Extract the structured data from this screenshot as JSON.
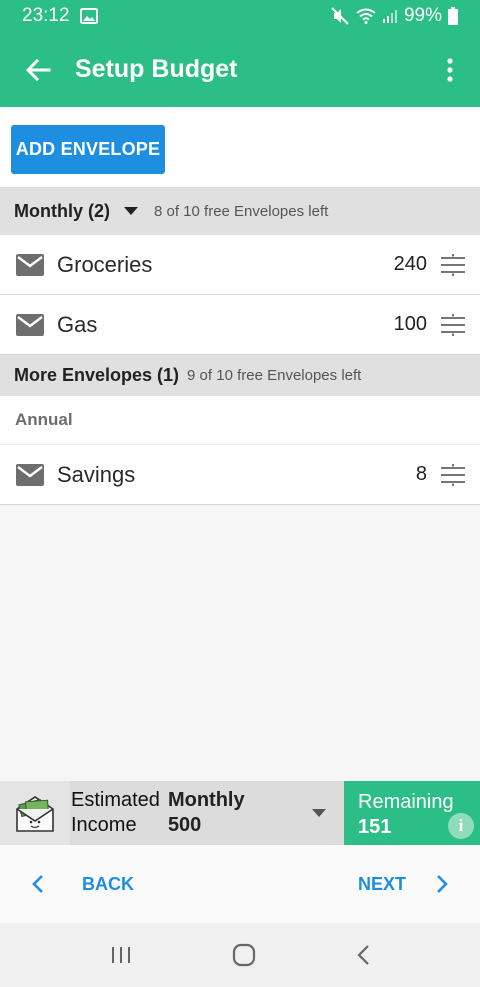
{
  "status_bar": {
    "time": "23:12",
    "battery": "99%"
  },
  "app_bar": {
    "title": "Setup Budget"
  },
  "actions": {
    "add_envelope": "ADD ENVELOPE"
  },
  "groups": [
    {
      "title": "Monthly (2)",
      "free_left": "8 of 10 free Envelopes left",
      "envelopes": [
        {
          "name": "Groceries",
          "amount": "240"
        },
        {
          "name": "Gas",
          "amount": "100"
        }
      ]
    },
    {
      "title": "More Envelopes (1)",
      "free_left": "9 of 10 free Envelopes left",
      "subheader": "Annual",
      "envelopes": [
        {
          "name": "Savings",
          "amount": "8"
        }
      ]
    }
  ],
  "income": {
    "label_line1": "Estimated",
    "label_line2": "Income",
    "period": "Monthly",
    "amount": "500"
  },
  "remaining": {
    "label": "Remaining",
    "value": "151"
  },
  "nav": {
    "back": "BACK",
    "next": "NEXT"
  },
  "colors": {
    "primary_green": "#2bbf87",
    "accent_blue": "#1e8fe0"
  }
}
